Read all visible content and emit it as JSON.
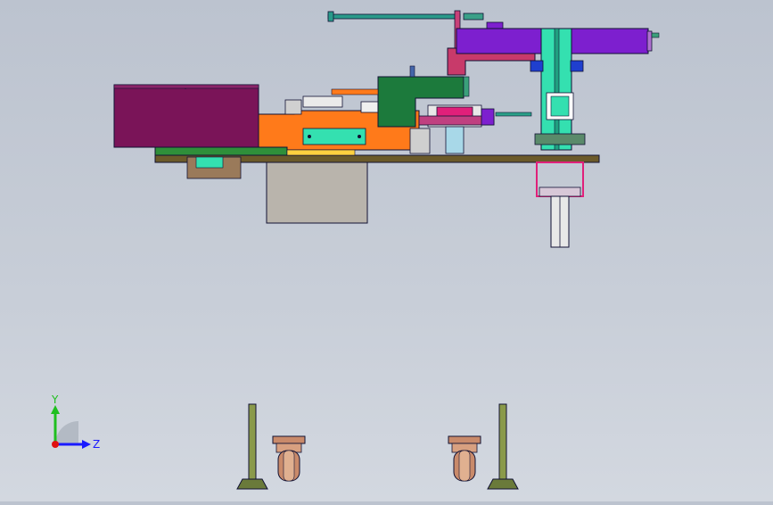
{
  "viewport": {
    "background_top": "#bcc3cf",
    "background_bottom": "#d3d8e0"
  },
  "triad": {
    "y_label": "Y",
    "z_label": "Z",
    "y_color": "#1fbf1f",
    "z_color": "#1a1aff",
    "x_color": "#e01010"
  },
  "colors": {
    "purple_box": "#7a1458",
    "orange_plate": "#ff7a1a",
    "violet_beam": "#7d1fcf",
    "teal": "#34e0b0",
    "green_frame": "#1c7a3c",
    "olive_frame": "#6b5a2a",
    "grey_block": "#b9b4ac",
    "magenta": "#e0207a",
    "copper": "#c98a6a"
  }
}
